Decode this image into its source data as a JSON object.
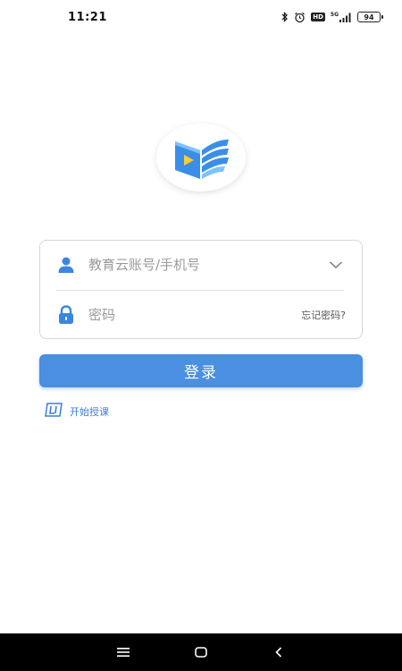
{
  "status_bar": {
    "time": "11:21",
    "hd_label": "HD",
    "network_label": "5G",
    "battery_level": "94",
    "icons": [
      "bluetooth-icon",
      "alarm-icon",
      "hd-icon",
      "signal-icon",
      "battery-icon"
    ]
  },
  "logo": {
    "icon": "book-play-logo",
    "colors": {
      "blue": "#3a8ee8",
      "yellow": "#ffcc33",
      "light_blue": "#7cc2ff"
    }
  },
  "login_form": {
    "account": {
      "icon": "user-icon",
      "placeholder": "教育云账号/手机号",
      "value": ""
    },
    "account_dropdown_icon": "chevron-down-icon",
    "password": {
      "icon": "lock-icon",
      "placeholder": "密码",
      "value": ""
    },
    "forgot_password": "忘记密码?"
  },
  "login_button": {
    "label": "登录",
    "color": "#4a8fe0"
  },
  "start_teaching": {
    "icon": "teach-icon",
    "label": "开始授课",
    "color": "#3b7fd6"
  },
  "navigation_bar": {
    "buttons": [
      "menu-icon",
      "home-icon",
      "back-icon"
    ]
  }
}
